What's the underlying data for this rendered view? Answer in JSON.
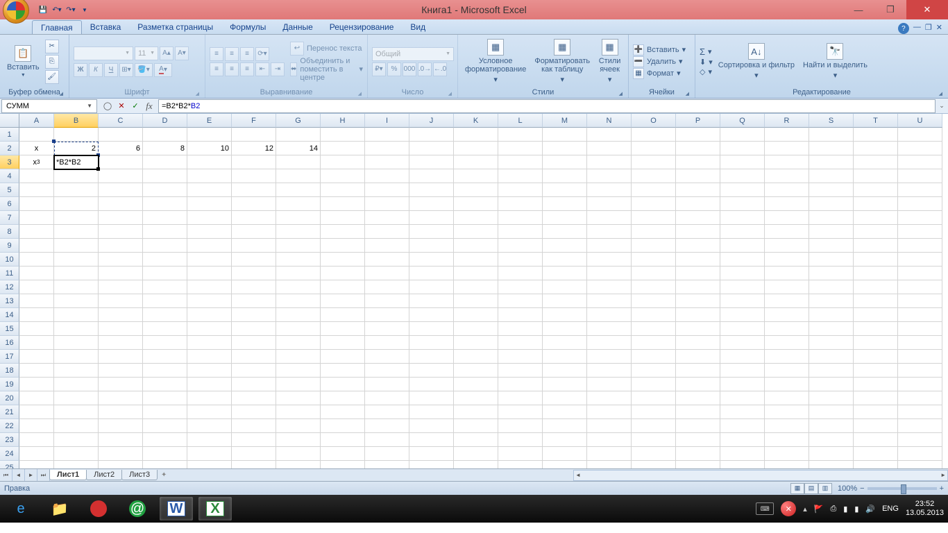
{
  "title": "Книга1 - Microsoft Excel",
  "tabs": [
    "Главная",
    "Вставка",
    "Разметка страницы",
    "Формулы",
    "Данные",
    "Рецензирование",
    "Вид"
  ],
  "active_tab": 0,
  "ribbon": {
    "clipboard": {
      "label": "Буфер обмена",
      "paste": "Вставить"
    },
    "font": {
      "label": "Шрифт",
      "name": "",
      "size": "11",
      "bold": "Ж",
      "italic": "К",
      "underline": "Ч"
    },
    "align": {
      "label": "Выравнивание",
      "wrap": "Перенос текста",
      "merge": "Объединить и поместить в центре"
    },
    "number": {
      "label": "Число",
      "format": "Общий"
    },
    "styles": {
      "label": "Стили",
      "cond": "Условное форматирование",
      "table": "Форматировать как таблицу",
      "cell": "Стили ячеек"
    },
    "cells": {
      "label": "Ячейки",
      "insert": "Вставить",
      "delete": "Удалить",
      "format_": "Формат"
    },
    "edit": {
      "label": "Редактирование",
      "sort": "Сортировка и фильтр",
      "find": "Найти и выделить"
    }
  },
  "name_box": "СУММ",
  "formula": {
    "prefix": "=B2*B2*",
    "ref": "B2"
  },
  "columns": [
    "A",
    "B",
    "C",
    "D",
    "E",
    "F",
    "G",
    "H",
    "I",
    "J",
    "K",
    "L",
    "M",
    "N",
    "O",
    "P",
    "Q",
    "R",
    "S",
    "T",
    "U"
  ],
  "rows": 25,
  "selected_col": "B",
  "selected_row": 3,
  "cells_data": {
    "A2": {
      "text": "x",
      "align": "center"
    },
    "B2": {
      "text": "2",
      "align": "right"
    },
    "C2": {
      "text": "6",
      "align": "right"
    },
    "D2": {
      "text": "8",
      "align": "right"
    },
    "E2": {
      "text": "10",
      "align": "right"
    },
    "F2": {
      "text": "12",
      "align": "right"
    },
    "G2": {
      "text": "14",
      "align": "right"
    },
    "A3": {
      "html": "x<sup>3</sup>",
      "align": "center"
    },
    "B3": {
      "text": "*B2*B2",
      "align": "left",
      "editing": true
    }
  },
  "sheets": [
    "Лист1",
    "Лист2",
    "Лист3"
  ],
  "active_sheet": 0,
  "status_mode": "Правка",
  "zoom": "100%",
  "lang": "ENG",
  "clock": {
    "time": "23:52",
    "date": "13.05.2013"
  }
}
